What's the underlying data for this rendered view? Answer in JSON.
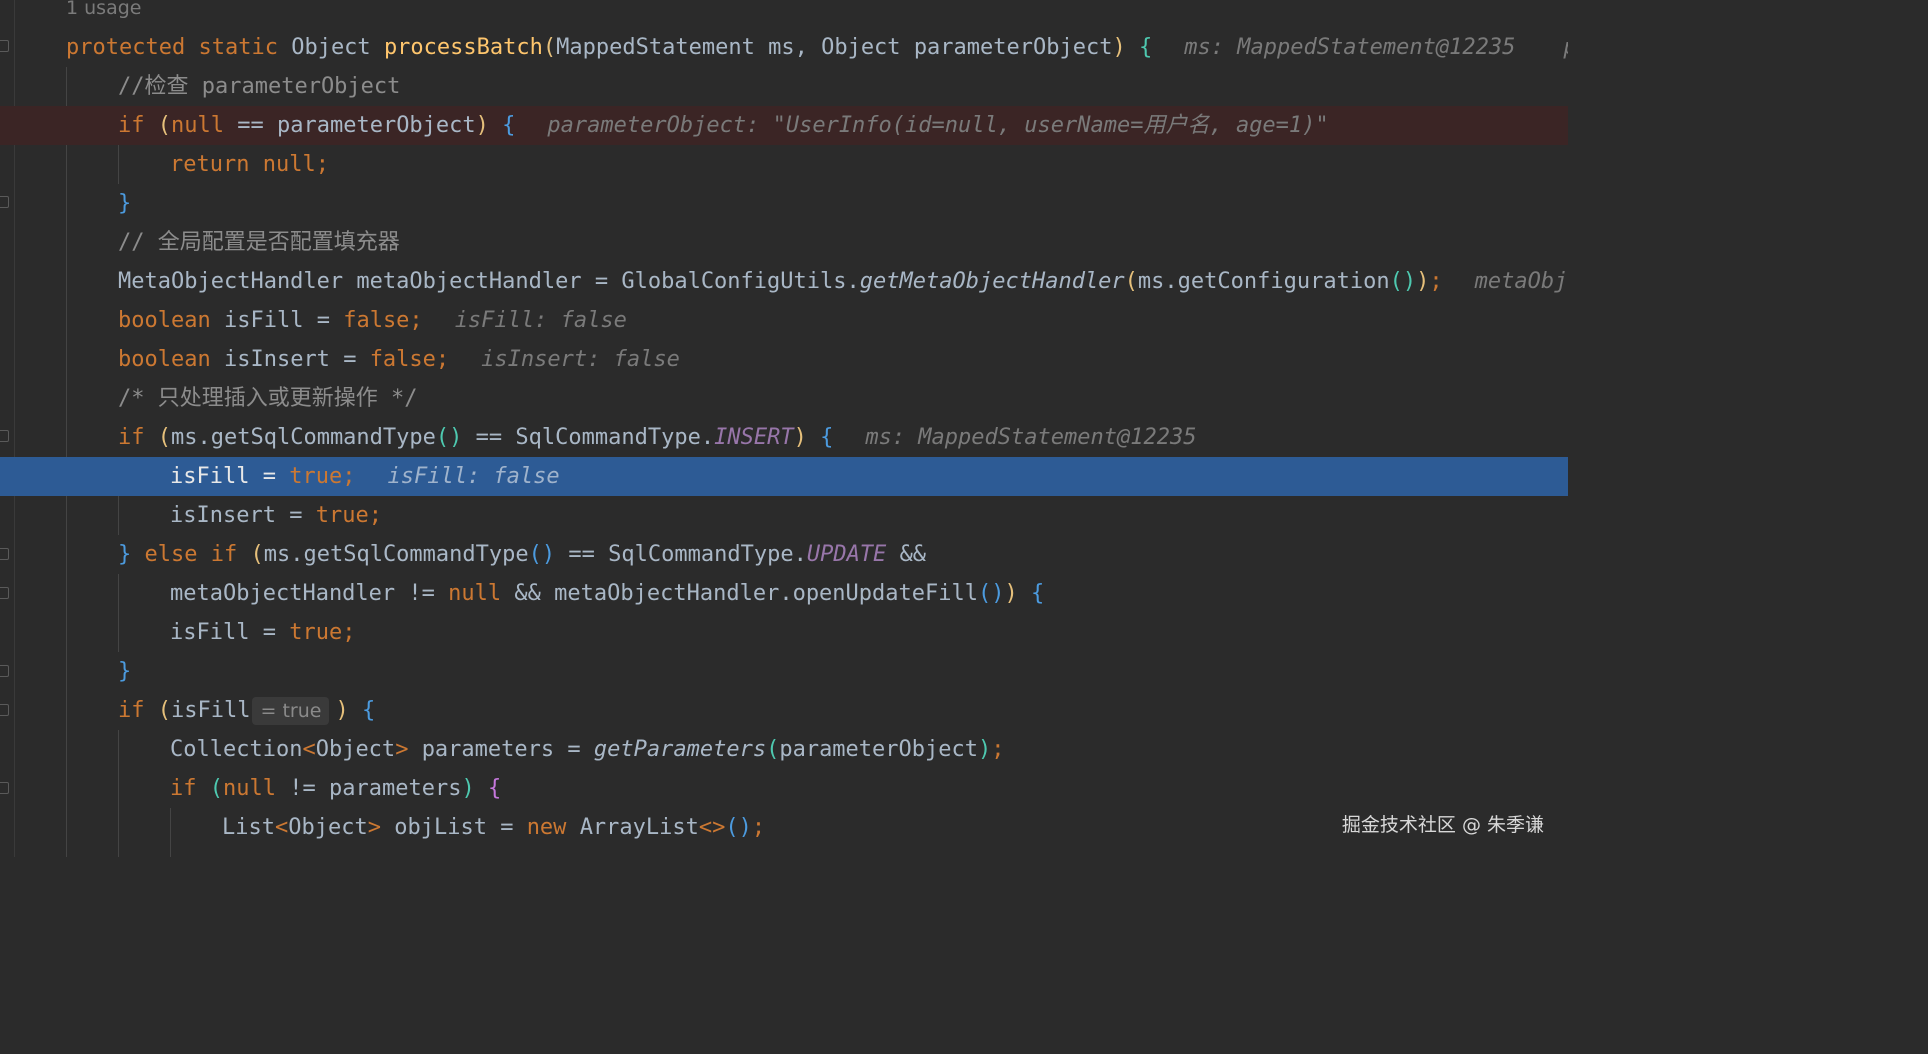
{
  "editor": {
    "usage_label": "1 usage",
    "lines": [
      {
        "id": "sig",
        "keyword1": "protected",
        "keyword2": "static",
        "ret_type": "Object",
        "method": "processBatch",
        "param1_type": "MappedStatement",
        "param1": "ms,",
        "param2_type": "Object",
        "param2": "parameterObject",
        "hint": "ms: MappedStatement@12235",
        "hint_cut": "pa"
      },
      {
        "id": "cmt1",
        "text": "//检查 parameterObject"
      },
      {
        "id": "if1",
        "kw": "if",
        "kw_null": "null",
        "op": "==",
        "var": "parameterObject",
        "hint": "parameterObject: \"UserInfo(id=null, userName=用户名, age=1)\""
      },
      {
        "id": "ret",
        "kw": "return",
        "kw_null": "null;"
      },
      {
        "id": "close1",
        "text": "}"
      },
      {
        "id": "cmt2",
        "text": "// 全局配置是否配置填充器"
      },
      {
        "id": "mot",
        "type": "MetaObjectHandler",
        "var": "metaObjectHandler",
        "op": "=",
        "cls": "GlobalConfigUtils.",
        "method": "getMetaObjectHandler",
        "arg": "ms.getConfiguration",
        "hint": "metaObjec"
      },
      {
        "id": "isfill",
        "kw": "boolean",
        "var": "isFill",
        "op": "=",
        "val": "false;",
        "hint": "isFill: false"
      },
      {
        "id": "isinsert",
        "kw": "boolean",
        "var": "isInsert",
        "op": "=",
        "val": "false;",
        "hint": "isInsert: false"
      },
      {
        "id": "cmt3",
        "text": "/* 只处理插入或更新操作 */"
      },
      {
        "id": "if2",
        "kw": "if",
        "expr": "ms.getSqlCommandType",
        "op": "==",
        "cls": "SqlCommandType.",
        "const": "INSERT",
        "hint": "ms: MappedStatement@12235"
      },
      {
        "id": "setfill1",
        "var": "isFill",
        "op": "=",
        "val": "true;",
        "hint": "isFill: false"
      },
      {
        "id": "setinsert",
        "var": "isInsert",
        "op": "=",
        "val": "true;"
      },
      {
        "id": "elseif",
        "kw_else": "else",
        "kw_if": "if",
        "expr": "ms.getSqlCommandType",
        "op": "==",
        "cls": "SqlCommandType.",
        "const": "UPDATE",
        "op2": "&&"
      },
      {
        "id": "cond2",
        "var": "metaObjectHandler",
        "op": "!=",
        "kw_null": "null",
        "op2": "&&",
        "call": "metaObjectHandler.openUpdateFill"
      },
      {
        "id": "setfill2",
        "var": "isFill",
        "op": "=",
        "val": "true;"
      },
      {
        "id": "close2",
        "text": "}"
      },
      {
        "id": "if3",
        "kw": "if",
        "var": "isFill",
        "inlay": "= true"
      },
      {
        "id": "coll",
        "type": "Collection",
        "generic": "Object",
        "var": "parameters",
        "op": "=",
        "method": "getParameters",
        "arg": "parameterObject"
      },
      {
        "id": "if4",
        "kw": "if",
        "kw_null": "null",
        "op": "!=",
        "var": "parameters"
      },
      {
        "id": "list",
        "type": "List",
        "generic": "Object",
        "var": "objList",
        "op": "=",
        "kw_new": "new",
        "cls": "ArrayList"
      }
    ]
  },
  "watermark": "掘金技术社区 @ 朱季谦",
  "colors": {
    "background": "#2b2b2b",
    "keyword": "#cc7832",
    "method": "#ffc66d",
    "comment": "#8c8c8c",
    "constant": "#9876aa",
    "current_line": "#2d5b95",
    "error_line": "#3b2525"
  }
}
